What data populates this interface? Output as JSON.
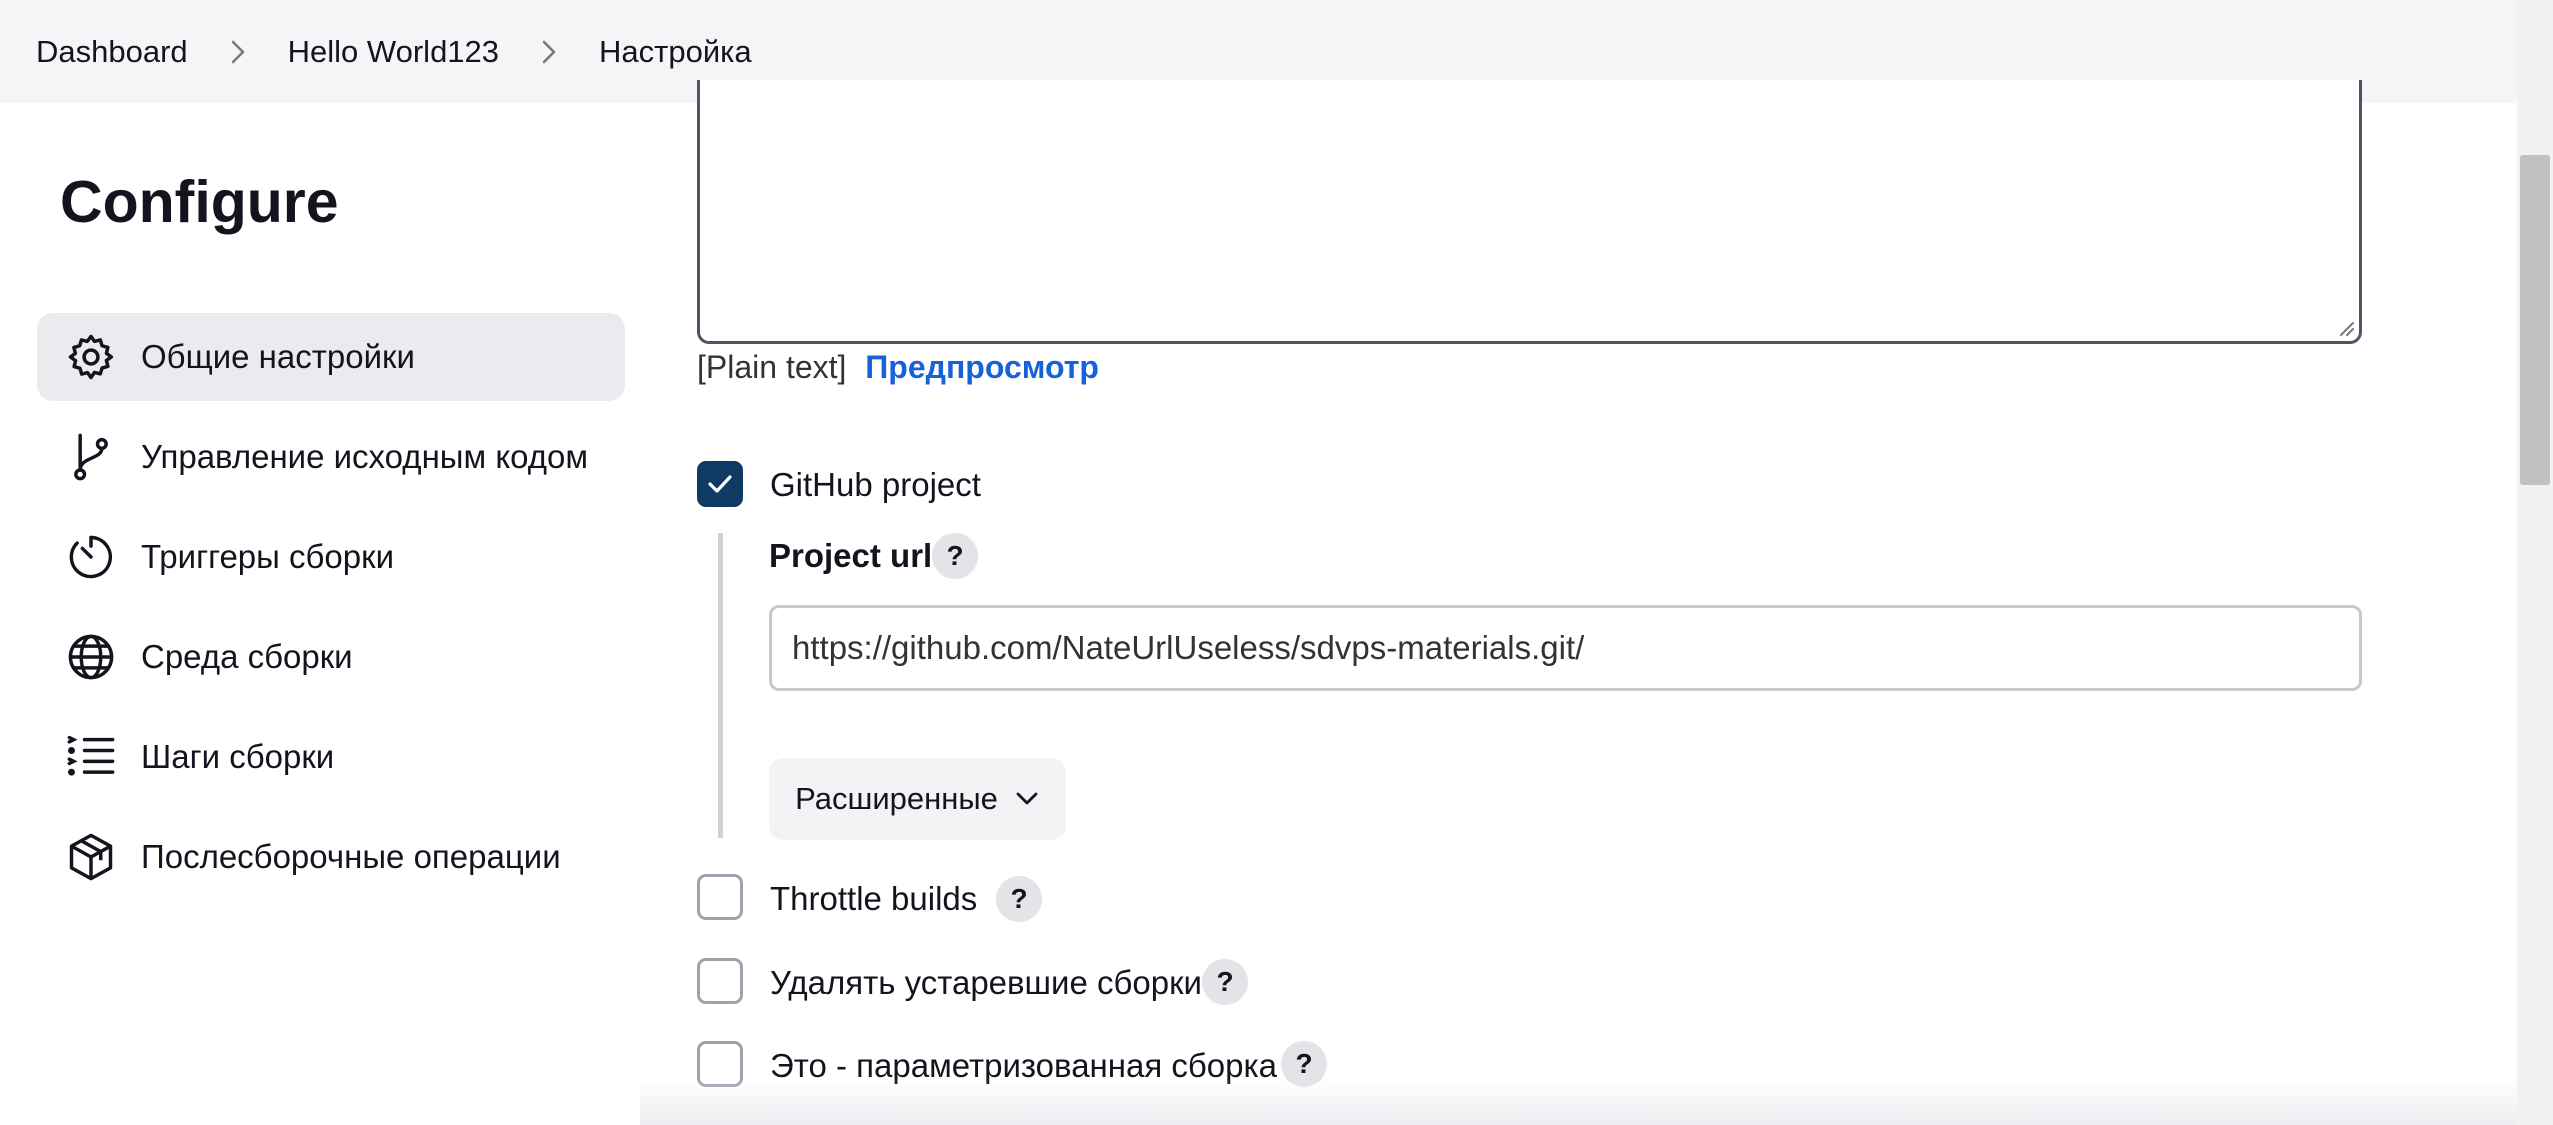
{
  "breadcrumb": {
    "items": [
      "Dashboard",
      "Hello World123",
      "Настройка"
    ]
  },
  "page": {
    "title": "Configure"
  },
  "sidebar": {
    "items": [
      {
        "label": "Общие настройки",
        "icon": "gear-icon",
        "active": true
      },
      {
        "label": "Управление исходным кодом",
        "icon": "branch-icon",
        "active": false
      },
      {
        "label": "Триггеры сборки",
        "icon": "timer-icon",
        "active": false
      },
      {
        "label": "Среда сборки",
        "icon": "globe-icon",
        "active": false
      },
      {
        "label": "Шаги сборки",
        "icon": "list-icon",
        "active": false
      },
      {
        "label": "Послесборочные операции",
        "icon": "package-icon",
        "active": false
      }
    ]
  },
  "description": {
    "plain_text_label": "[Plain text]",
    "preview_link": "Предпросмотр"
  },
  "github_project": {
    "label": "GitHub project",
    "checked": true,
    "project_url_label": "Project url",
    "project_url_value": "https://github.com/NateUrlUseless/sdvps-materials.git/",
    "advanced_button": "Расширенные"
  },
  "options": [
    {
      "label": "Throttle builds",
      "checked": false
    },
    {
      "label": "Удалять устаревшие сборки",
      "checked": false
    },
    {
      "label": "Это - параметризованная сборка",
      "checked": false
    }
  ],
  "help_glyph": "?",
  "colors": {
    "accent": "#0e3a63",
    "link": "#1762d6",
    "active_item_bg": "#ebebef",
    "header_bg": "#f5f5f7"
  }
}
